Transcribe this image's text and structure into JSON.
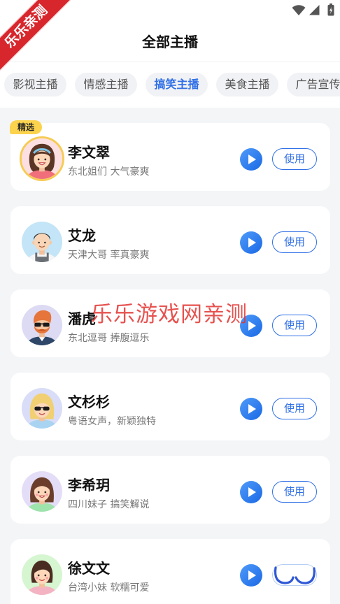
{
  "status_bar": {
    "ribbon_text": "乐乐亲测",
    "wifi_icon": "wifi-icon",
    "signal_icon": "signal-icon",
    "battery_icon": "battery-charging-icon"
  },
  "header": {
    "title": "全部主播"
  },
  "tabs": [
    {
      "label": "影视主播",
      "selected": false
    },
    {
      "label": "情感主播",
      "selected": false
    },
    {
      "label": "搞笑主播",
      "selected": true
    },
    {
      "label": "美食主播",
      "selected": false
    },
    {
      "label": "广告宣传",
      "selected": false
    }
  ],
  "use_label": "使用",
  "play_icon": "play-icon",
  "anchors": [
    {
      "name": "李文翠",
      "desc": "东北姐们 大气豪爽",
      "badge": "精选",
      "featured": true,
      "avatar": {
        "bg": "#fcdfe2",
        "hair": "#5a3526",
        "shirt": "#f06f7a"
      }
    },
    {
      "name": "艾龙",
      "desc": "天津大哥 率真豪爽",
      "featured": false,
      "avatar": {
        "bg": "#c3e5f7",
        "hair": "#2b2b2b",
        "shirt": "#6a6f75"
      }
    },
    {
      "name": "潘虎",
      "desc": "东北逗哥 捧腹逗乐",
      "featured": false,
      "avatar": {
        "bg": "#dddaf4",
        "hair": "#e5753a",
        "shirt": "#2e4668"
      }
    },
    {
      "name": "文杉杉",
      "desc": "粤语女声，新颖独特",
      "featured": false,
      "avatar": {
        "bg": "#d9ddf7",
        "hair": "#f1cf73",
        "shirt": "#a8d4f2"
      }
    },
    {
      "name": "李希玥",
      "desc": "四川妹子 搞笑解说",
      "featured": false,
      "avatar": {
        "bg": "#e4ddf7",
        "hair": "#6b3e2b",
        "shirt": "#9fe3ac"
      }
    },
    {
      "name": "徐文文",
      "desc": "台湾小妹 软糯可爱",
      "featured": false,
      "avatar": {
        "bg": "#d6f5d1",
        "hair": "#4a2d22",
        "shirt": "#f4b3c3"
      }
    }
  ],
  "watermark": "乐乐游戏网亲测",
  "colors": {
    "accent": "#2f6fe6",
    "badge": "#fbd34d",
    "ribbon": "#d7262c",
    "watermark": "#e23430",
    "page_bg": "#f4f5f7"
  }
}
